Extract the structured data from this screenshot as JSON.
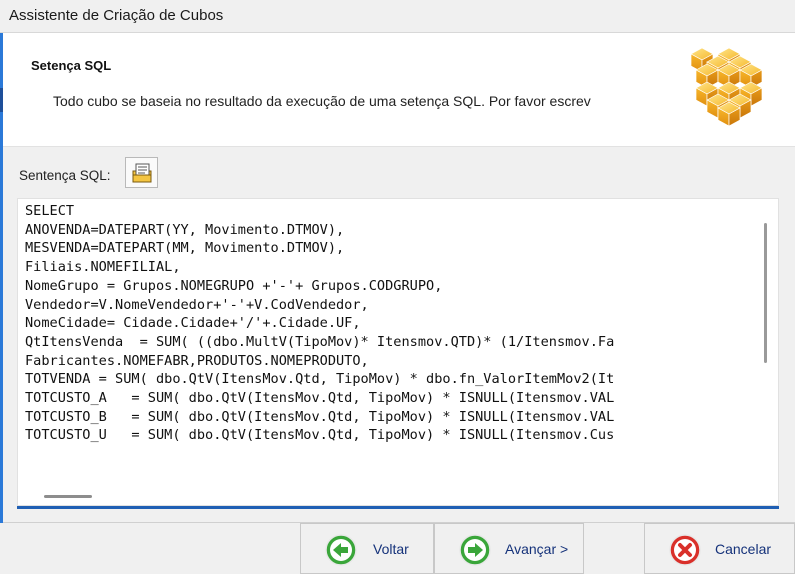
{
  "window": {
    "title": "Assistente de Criação de Cubos"
  },
  "header": {
    "title": "Setença SQL",
    "description": "Todo cubo se baseia no resultado da execução de uma setença SQL. Por favor escrev"
  },
  "sql_section": {
    "label": "Sentença SQL:"
  },
  "sql_editor": {
    "lines": [
      "SELECT",
      "ANOVENDA=DATEPART(YY, Movimento.DTMOV),",
      "MESVENDA=DATEPART(MM, Movimento.DTMOV),",
      "Filiais.NOMEFILIAL,",
      "NomeGrupo = Grupos.NOMEGRUPO +'-'+ Grupos.CODGRUPO,",
      "Vendedor=V.NomeVendedor+'-'+V.CodVendedor,",
      "NomeCidade= Cidade.Cidade+'/'+.Cidade.UF,",
      "QtItensVenda  = SUM( ((dbo.MultV(TipoMov)* Itensmov.QTD)* (1/Itensmov.Fa",
      "Fabricantes.NOMEFABR,PRODUTOS.NOMEPRODUTO,",
      "TOTVENDA = SUM( dbo.QtV(ItensMov.Qtd, TipoMov) * dbo.fn_ValorItemMov2(It",
      "TOTCUSTO_A   = SUM( dbo.QtV(ItensMov.Qtd, TipoMov) * ISNULL(Itensmov.VAL",
      "TOTCUSTO_B   = SUM( dbo.QtV(ItensMov.Qtd, TipoMov) * ISNULL(Itensmov.VAL",
      "TOTCUSTO_U   = SUM( dbo.QtV(ItensMov.Qtd, TipoMov) * ISNULL(Itensmov.Cus"
    ]
  },
  "footer": {
    "back_label": "Voltar",
    "next_label": "Avançar >",
    "cancel_label": "Cancelar"
  },
  "colors": {
    "accent": "#1f5fb4",
    "button_text": "#15327a",
    "back_next_icon": "#3aa63a",
    "cancel_icon": "#d9302a"
  }
}
